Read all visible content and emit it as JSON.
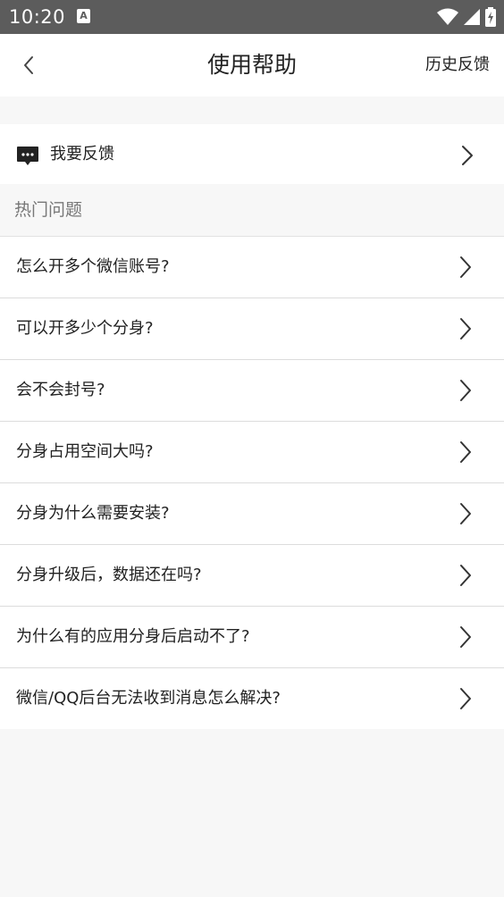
{
  "status_bar": {
    "time": "10:20",
    "notification_icon_letter": "A",
    "icons": [
      "wifi-icon",
      "cellular-signal-icon",
      "battery-icon"
    ]
  },
  "header": {
    "title": "使用帮助",
    "back_icon": "chevron-left-icon",
    "history_label": "历史反馈"
  },
  "feedback": {
    "icon": "chat-bubble-icon",
    "label": "我要反馈"
  },
  "hot_questions": {
    "title": "热门问题",
    "items": [
      {
        "label": "怎么开多个微信账号?"
      },
      {
        "label": "可以开多少个分身?"
      },
      {
        "label": "会不会封号?"
      },
      {
        "label": "分身占用空间大吗?"
      },
      {
        "label": "分身为什么需要安装?"
      },
      {
        "label": "分身升级后，数据还在吗?"
      },
      {
        "label": "为什么有的应用分身后启动不了?"
      },
      {
        "label": "微信/QQ后台无法收到消息怎么解决?"
      }
    ]
  },
  "colors": {
    "status_bar": "#5c5c5c",
    "page_background": "#f7f7f7",
    "card_background": "#ffffff",
    "text": "#222222",
    "section_header_text": "#777777",
    "divider": "#dcdcdc"
  }
}
